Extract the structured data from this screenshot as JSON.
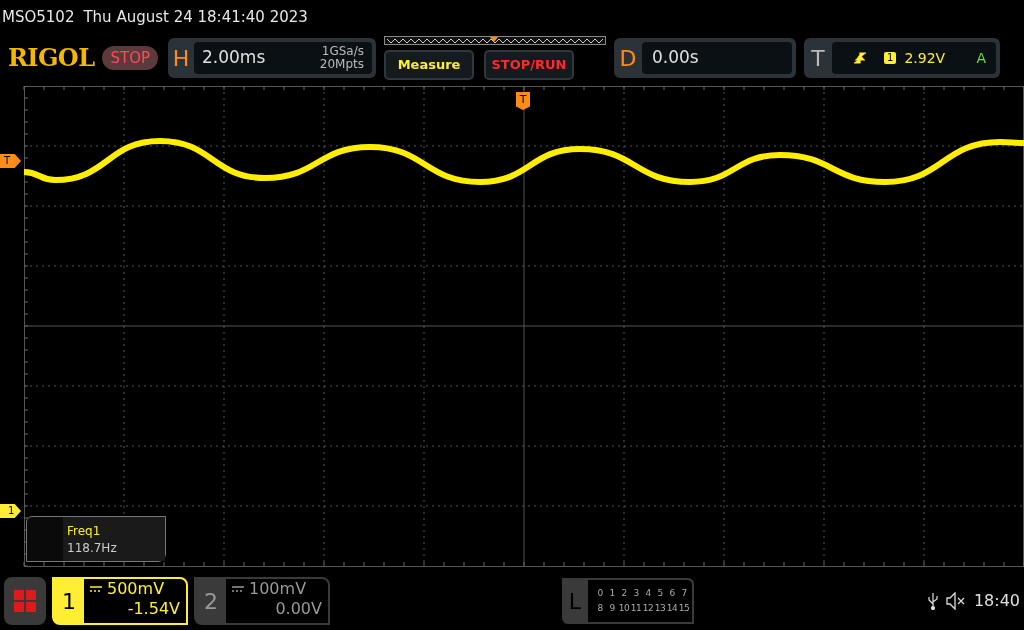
{
  "title_bar": {
    "model": "MSO5102",
    "datetime": "Thu August 24 18:41:40 2023"
  },
  "toolbar": {
    "logo": "RIGOL",
    "run_state": "STOP",
    "horizontal": {
      "letter": "H",
      "timebase": "2.00ms",
      "sample_rate": "1GSa/s",
      "memory_depth": "20Mpts"
    },
    "buttons": [
      {
        "label": "Measure",
        "kind": "measure"
      },
      {
        "label": "STOP/RUN",
        "kind": "stoprun"
      }
    ],
    "delay": {
      "letter": "D",
      "value": "0.00s"
    },
    "trigger": {
      "letter": "T",
      "source": "1",
      "level": "2.92V",
      "mode": "A"
    }
  },
  "display": {
    "trigger_position_marker": "T",
    "trigger_level_marker": "T",
    "channel_marker": "1",
    "measurement": {
      "name": "Freq1",
      "value": "118.7Hz"
    }
  },
  "bottom_bar": {
    "channels": [
      {
        "number": "1",
        "scale": "500mV",
        "offset": "-1.54V",
        "selected": true
      },
      {
        "number": "2",
        "scale": "100mV",
        "offset": "0.00V",
        "selected": false
      }
    ],
    "logic": {
      "letter": "L",
      "rows": [
        [
          "0",
          "1",
          "2",
          "3",
          "4",
          "5",
          "6",
          "7"
        ],
        [
          "8",
          "9",
          "10",
          "11",
          "12",
          "13",
          "14",
          "15"
        ]
      ]
    },
    "time": "18:40"
  }
}
